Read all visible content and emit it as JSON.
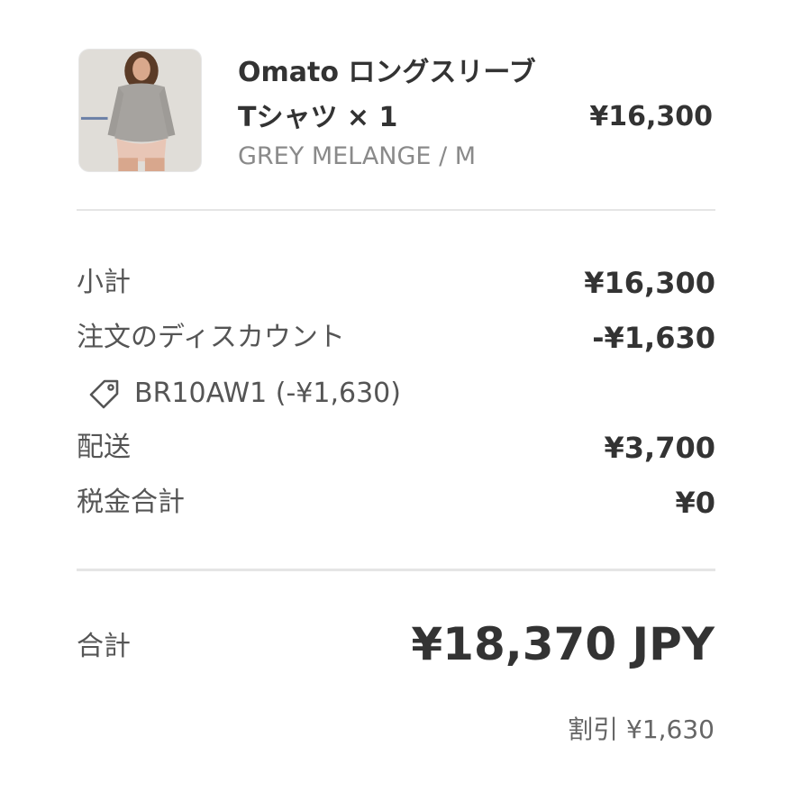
{
  "product": {
    "name": "Omato ロングスリーブTシャツ × 1",
    "variant": "GREY MELANGE / M",
    "price": "¥16,300",
    "image_alt": "model wearing grey long sleeve t-shirt"
  },
  "summary": {
    "subtotal_label": "小計",
    "subtotal_value": "¥16,300",
    "discount_label": "注文のディスカウント",
    "discount_value": "-¥1,630",
    "discount_code": "BR10AW1 (-¥1,630)",
    "shipping_label": "配送",
    "shipping_value": "¥3,700",
    "tax_label": "税金合計",
    "tax_value": "¥0"
  },
  "total": {
    "label": "合計",
    "value": "¥18,370 JPY",
    "savings": "割引 ¥1,630"
  },
  "icons": {
    "discount": "tag-icon"
  },
  "colors": {
    "text_primary": "#333333",
    "text_secondary": "#8a8a8a",
    "divider": "#e5e5e5"
  }
}
